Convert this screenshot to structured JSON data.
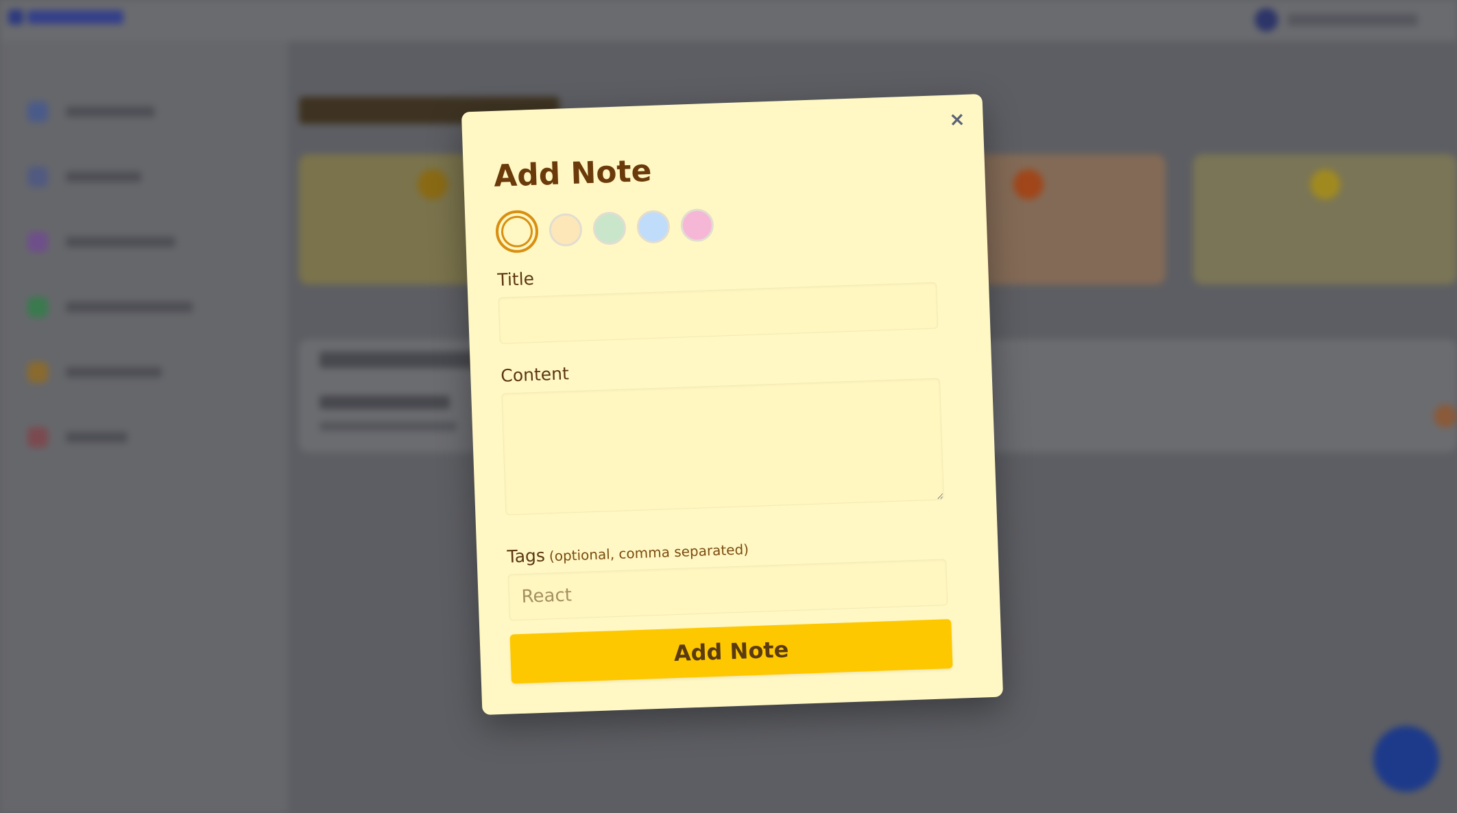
{
  "modal": {
    "title": "Add Note",
    "close_glyph": "×",
    "title_label": "Title",
    "content_label": "Content",
    "tags_label": "Tags",
    "tags_hint": "(optional, comma separated)",
    "tags_placeholder": "React",
    "submit_label": "Add Note",
    "swatches": [
      {
        "color": "#fff8c4",
        "selected": true
      },
      {
        "color": "#fde7b8",
        "selected": false
      },
      {
        "color": "#c9e6cb",
        "selected": false
      },
      {
        "color": "#bfdcfb",
        "selected": false
      },
      {
        "color": "#f6b7d6",
        "selected": false
      }
    ]
  },
  "colors": {
    "modal_background": "#fff8c4",
    "accent": "#fec800",
    "title_text": "#6b3a0a",
    "selected_ring": "#d88f12"
  }
}
